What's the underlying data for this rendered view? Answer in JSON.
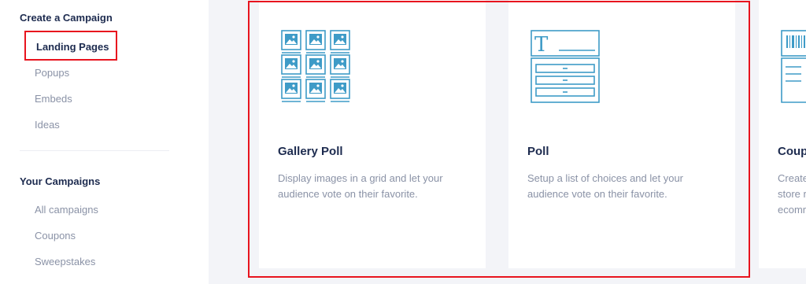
{
  "sidebar": {
    "create_title": "Create a Campaign",
    "create_items": [
      "Landing Pages",
      "Popups",
      "Embeds",
      "Ideas"
    ],
    "your_title": "Your Campaigns",
    "your_items": [
      "All campaigns",
      "Coupons",
      "Sweepstakes"
    ]
  },
  "cards": [
    {
      "title": "Gallery Poll",
      "desc_lines": [
        "Display images in a grid and let your",
        "audience vote on their favorite."
      ],
      "icon": "image-grid-icon"
    },
    {
      "title": "Poll",
      "desc_lines": [
        "Setup a list of choices and let your",
        "audience vote on their favorite."
      ],
      "icon": "poll-list-icon"
    },
    {
      "title": "Coup",
      "desc_lines": [
        "Create",
        "store r",
        "ecomr"
      ],
      "icon": "coupon-barcode-icon"
    }
  ],
  "colors": {
    "accent_blue": "#3e9bc7",
    "highlight_red": "#e8141e",
    "title_navy": "#1d2b4f"
  }
}
